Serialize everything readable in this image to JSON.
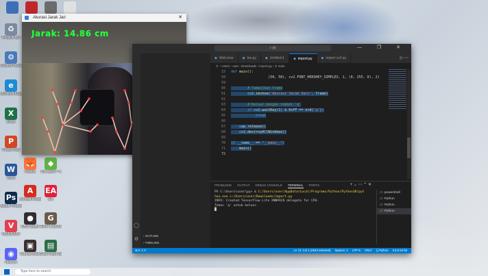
{
  "desktop": {
    "icons_top": [
      {
        "label": "",
        "color": "#3d6fb6"
      },
      {
        "label": "",
        "color": "#c0272d"
      },
      {
        "label": "",
        "color": "#6b6b6b"
      },
      {
        "label": "",
        "color": "#e0e0e0"
      }
    ],
    "icons_left": [
      {
        "label": "Recycle Bin",
        "glyph": "♻",
        "color": "#7a8aa0"
      },
      {
        "label": "Control Panel",
        "glyph": "⚙",
        "color": "#4a7ab8"
      },
      {
        "label": "Microsoft Edge",
        "glyph": "e",
        "color": "#1f8ad6"
      },
      {
        "label": "Excel",
        "glyph": "X",
        "color": "#1e7145"
      },
      {
        "label": "PowerPoint",
        "glyph": "P",
        "color": "#d24726"
      },
      {
        "label": "Word",
        "glyph": "W",
        "color": "#2b579a"
      },
      {
        "label": "Adobe Photoshop",
        "glyph": "Ps",
        "color": "#0f2a4a"
      },
      {
        "label": "VALORANT",
        "glyph": "V",
        "color": "#e04050"
      },
      {
        "label": "Discord",
        "glyph": "◉",
        "color": "#5865f2"
      }
    ],
    "icons_mid": [
      {
        "label": "Firefox",
        "glyph": "🦊",
        "color": "#ff7139"
      },
      {
        "label": "Acrobat Reader",
        "glyph": "A",
        "color": "#d62b1f"
      },
      {
        "label": "OBS Studio",
        "glyph": "●",
        "color": "#302e31"
      },
      {
        "label": "Manual Book",
        "glyph": "▣",
        "color": "#3b2f2f"
      }
    ],
    "icons_right": [
      {
        "label": "The Sims™ 4",
        "glyph": "◆",
        "color": "#62b246"
      },
      {
        "label": "EA",
        "glyph": "EA",
        "color": "#e0203a"
      },
      {
        "label": "GIMP 2.10.36",
        "glyph": "G",
        "color": "#6b5a4a"
      },
      {
        "label": "Cara Paket Saran",
        "glyph": "▤",
        "color": "#2c6e4a"
      }
    ]
  },
  "camera_window": {
    "title": "Akurasi Jarak Jari",
    "distance_text": "Jarak: 14.86 cm",
    "close_glyph": "✕",
    "skeleton_color": "#e8b0a0"
  },
  "vscode": {
    "search_text": "py",
    "window_buttons": "— ❐ ✕",
    "tabs": [
      {
        "label": "Welcome",
        "active": false
      },
      {
        "label": "tes.py",
        "active": false
      },
      {
        "label": "Untitled-1",
        "active": false
      },
      {
        "label": "import.py",
        "active": true
      },
      {
        "label": "import cv2.py",
        "active": false
      }
    ],
    "tab_actions": "▷ ⋯",
    "breadcrumb": "C: › Users › user › Downloads › import.py › ⊙ main",
    "code_lines": [
      {
        "num": "15",
        "tokens": [
          {
            "c": "kw",
            "t": "def "
          },
          {
            "c": "fn",
            "t": "main"
          },
          {
            "c": "pl",
            "t": "():"
          }
        ]
      },
      {
        "num": "58",
        "tokens": [
          {
            "c": "pl",
            "t": "                  (50, 50), cv2.FONT_HERSHEY_SIMPLEX, 1, (0, 255, 0), 2)"
          }
        ]
      },
      {
        "num": "59",
        "tokens": []
      },
      {
        "num": "60",
        "tokens": [
          {
            "c": "cm",
            "t": "        # Tampilkan frame"
          }
        ]
      },
      {
        "num": "61",
        "tokens": [
          {
            "c": "id",
            "t": "        cv2"
          },
          {
            "c": "pl",
            "t": "."
          },
          {
            "c": "fn",
            "t": "imshow"
          },
          {
            "c": "pl",
            "t": "("
          },
          {
            "c": "str",
            "t": "'Akurasi Jarak Jari'"
          },
          {
            "c": "pl",
            "t": ", frame)"
          }
        ]
      },
      {
        "num": "62",
        "tokens": []
      },
      {
        "num": "63",
        "tokens": [
          {
            "c": "cm",
            "t": "        # Keluar dengan tombol 'q'"
          }
        ]
      },
      {
        "num": "64",
        "tokens": [
          {
            "c": "kw",
            "t": "        if "
          },
          {
            "c": "id",
            "t": "cv2"
          },
          {
            "c": "pl",
            "t": "."
          },
          {
            "c": "fn",
            "t": "waitKey"
          },
          {
            "c": "pl",
            "t": "(1) & 0xFF == "
          },
          {
            "c": "fn",
            "t": "ord"
          },
          {
            "c": "pl",
            "t": "("
          },
          {
            "c": "str",
            "t": "'q'"
          },
          {
            "c": "pl",
            "t": "):"
          }
        ]
      },
      {
        "num": "65",
        "tokens": [
          {
            "c": "kw",
            "t": "            break"
          }
        ]
      },
      {
        "num": "66",
        "tokens": []
      },
      {
        "num": "67",
        "tokens": [
          {
            "c": "id",
            "t": "    cap"
          },
          {
            "c": "pl",
            "t": "."
          },
          {
            "c": "fn",
            "t": "release"
          },
          {
            "c": "pl",
            "t": "()"
          }
        ]
      },
      {
        "num": "68",
        "tokens": [
          {
            "c": "id",
            "t": "    cv2"
          },
          {
            "c": "pl",
            "t": "."
          },
          {
            "c": "fn",
            "t": "destroyAllWindows"
          },
          {
            "c": "pl",
            "t": "()"
          }
        ]
      },
      {
        "num": "69",
        "tokens": []
      },
      {
        "num": "70",
        "tokens": [
          {
            "c": "kw",
            "t": "if "
          },
          {
            "c": "id",
            "t": "__name__"
          },
          {
            "c": "pl",
            "t": " == "
          },
          {
            "c": "str",
            "t": "\"__main__\""
          },
          {
            "c": "pl",
            "t": ":"
          }
        ]
      },
      {
        "num": "71",
        "tokens": [
          {
            "c": "fn",
            "t": "    main"
          },
          {
            "c": "pl",
            "t": "()"
          }
        ]
      },
      {
        "num": "72",
        "tokens": []
      }
    ],
    "sidebar_sections": {
      "outline": "OUTLINE",
      "timeline": "TIMELINE"
    },
    "panel_tabs": [
      {
        "label": "PROBLEMS",
        "active": false
      },
      {
        "label": "OUTPUT",
        "active": false
      },
      {
        "label": "DEBUG CONSOLE",
        "active": false
      },
      {
        "label": "TERMINAL",
        "active": true
      },
      {
        "label": "PORTS",
        "active": false
      }
    ],
    "panel_actions": "+ ⌄ ⋯ ⌃ ✕",
    "terminal_lines": [
      {
        "prefix": "PS C:\\Users\\user\\py> & ",
        "path": "C:/Users/user/AppData/Local/Programs/Python/Python38/pyt"
      },
      {
        "prefix": "",
        "path": "hon.exe c:/Users/user/Downloads/import.py"
      },
      {
        "prefix": "INFO: Created TensorFlow Lite XNNPACK delegate for CPU.",
        "path": ""
      },
      {
        "prefix": "Tekan 'q' untuk keluar.",
        "path": ""
      },
      {
        "prefix": "█",
        "path": ""
      }
    ],
    "terminal_list": [
      {
        "label": "powershell",
        "active": false
      },
      {
        "label": "Python",
        "active": false
      },
      {
        "label": "Python",
        "active": false
      },
      {
        "label": "Python",
        "active": true
      }
    ],
    "status_left": "⊗ 0 ⚠ 0",
    "status_items": [
      "Ln 72, Col 1 (2543 selected)",
      "Spaces: 4",
      "UTF-8",
      "CRLF",
      "{} Python",
      "3.8.9 64-bit"
    ],
    "accent": "#007acc"
  },
  "taskbar": {
    "search_placeholder": "Type here to search"
  }
}
